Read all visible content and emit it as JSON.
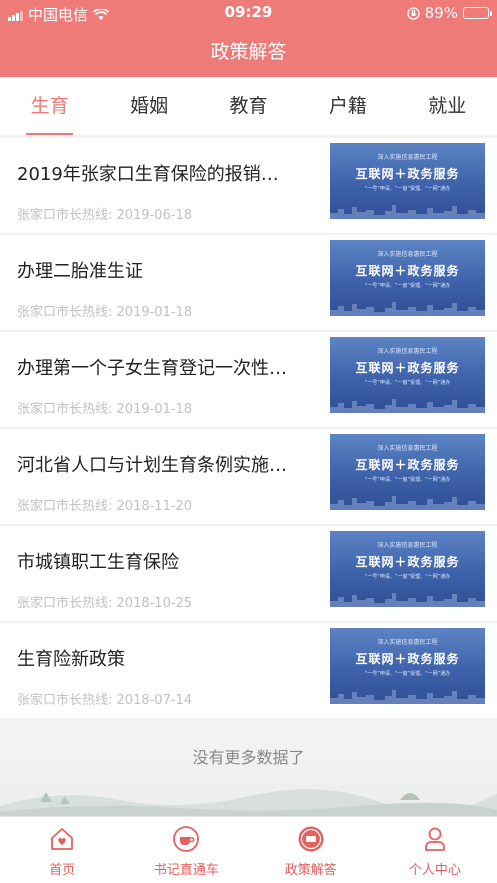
{
  "status_bar": {
    "carrier": "中国电信",
    "time": "09:29",
    "battery": "89%",
    "battery_level": 0.89
  },
  "nav": {
    "title": "政策解答"
  },
  "tabs": [
    {
      "label": "生育",
      "active": true
    },
    {
      "label": "婚姻",
      "active": false
    },
    {
      "label": "教育",
      "active": false
    },
    {
      "label": "户籍",
      "active": false
    },
    {
      "label": "就业",
      "active": false
    }
  ],
  "articles": [
    {
      "title": "2019年张家口生育保险的报销…",
      "source": "张家口市长热线",
      "date": "2019-06-18"
    },
    {
      "title": "办理二胎准生证",
      "source": "张家口市长热线",
      "date": "2019-01-18"
    },
    {
      "title": "办理第一个子女生育登记一次性…",
      "source": "张家口市长热线",
      "date": "2019-01-18"
    },
    {
      "title": "河北省人口与计划生育条例实施…",
      "source": "张家口市长热线",
      "date": "2018-11-20"
    },
    {
      "title": "市城镇职工生育保险",
      "source": "张家口市长热线",
      "date": "2018-10-25"
    },
    {
      "title": "生育险新政策",
      "source": "张家口市长热线",
      "date": "2018-07-14"
    }
  ],
  "thumbnail": {
    "small": "深入实施信息惠民工程",
    "big": "互联网＋政务服务",
    "sub": "“一号”申请、“一窗”受理、“一网”通办"
  },
  "list_end_text": "没有更多数据了",
  "tabbar": [
    {
      "label": "首页",
      "icon": "home-heart-icon"
    },
    {
      "label": "书记直通车",
      "icon": "coffee-cup-icon"
    },
    {
      "label": "政策解答",
      "icon": "policy-badge-icon"
    },
    {
      "label": "个人中心",
      "icon": "person-icon"
    }
  ],
  "colors": {
    "brand": "#ee7b78",
    "tabbar_accent": "#e4615f"
  }
}
